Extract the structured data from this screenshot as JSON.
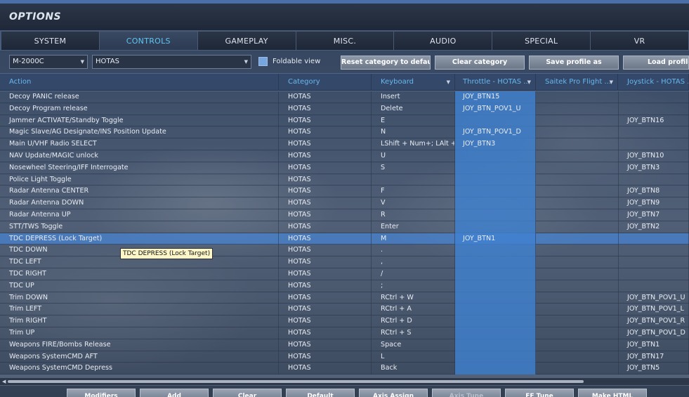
{
  "window": {
    "title": "OPTIONS"
  },
  "tabs": [
    {
      "label": "SYSTEM",
      "active": false
    },
    {
      "label": "CONTROLS",
      "active": true
    },
    {
      "label": "GAMEPLAY",
      "active": false
    },
    {
      "label": "MISC.",
      "active": false
    },
    {
      "label": "AUDIO",
      "active": false
    },
    {
      "label": "SPECIAL",
      "active": false
    },
    {
      "label": "VR",
      "active": false
    }
  ],
  "toolbar": {
    "aircraft_select": "M-2000C",
    "category_select": "HOTAS",
    "foldable_view_label": "Foldable view",
    "foldable_view_checked": true,
    "reset_category_label": "Reset category to default",
    "clear_category_label": "Clear category",
    "save_profile_label": "Save profile as",
    "load_profile_label": "Load profile"
  },
  "columns": {
    "action": "Action",
    "category": "Category",
    "keyboard": "Keyboard",
    "throttle": "Throttle - HOTAS ...",
    "saitek": "Saitek Pro Flight ...",
    "joystick": "Joystick - HOTAS ..."
  },
  "rows": [
    {
      "action": "Decoy PANIC release",
      "category": "HOTAS",
      "keyboard": "Insert",
      "throttle": "JOY_BTN15",
      "saitek": "",
      "joystick": ""
    },
    {
      "action": "Decoy Program release",
      "category": "HOTAS",
      "keyboard": "Delete",
      "throttle": "JOY_BTN_POV1_U",
      "saitek": "",
      "joystick": ""
    },
    {
      "action": "Jammer ACTIVATE/Standby Toggle",
      "category": "HOTAS",
      "keyboard": "E",
      "throttle": "",
      "saitek": "",
      "joystick": "JOY_BTN16"
    },
    {
      "action": "Magic Slave/AG Designate/INS Position Update",
      "category": "HOTAS",
      "keyboard": "N",
      "throttle": "JOY_BTN_POV1_D",
      "saitek": "",
      "joystick": ""
    },
    {
      "action": "Main U/VHF Radio SELECT",
      "category": "HOTAS",
      "keyboard": "LShift + Num+; LAlt +",
      "throttle": "JOY_BTN3",
      "saitek": "",
      "joystick": ""
    },
    {
      "action": "NAV Update/MAGIC unlock",
      "category": "HOTAS",
      "keyboard": "U",
      "throttle": "",
      "saitek": "",
      "joystick": "JOY_BTN10"
    },
    {
      "action": "Nosewheel Steering/IFF Interrogate",
      "category": "HOTAS",
      "keyboard": "S",
      "throttle": "",
      "saitek": "",
      "joystick": "JOY_BTN3"
    },
    {
      "action": "Police Light Toggle",
      "category": "HOTAS",
      "keyboard": "",
      "throttle": "",
      "saitek": "",
      "joystick": ""
    },
    {
      "action": "Radar Antenna CENTER",
      "category": "HOTAS",
      "keyboard": "F",
      "throttle": "",
      "saitek": "",
      "joystick": "JOY_BTN8"
    },
    {
      "action": "Radar Antenna DOWN",
      "category": "HOTAS",
      "keyboard": "V",
      "throttle": "",
      "saitek": "",
      "joystick": "JOY_BTN9"
    },
    {
      "action": "Radar Antenna UP",
      "category": "HOTAS",
      "keyboard": "R",
      "throttle": "",
      "saitek": "",
      "joystick": "JOY_BTN7"
    },
    {
      "action": "STT/TWS Toggle",
      "category": "HOTAS",
      "keyboard": "Enter",
      "throttle": "",
      "saitek": "",
      "joystick": "JOY_BTN2"
    },
    {
      "action": "TDC DEPRESS (Lock Target)",
      "category": "HOTAS",
      "keyboard": "M",
      "throttle": "JOY_BTN1",
      "saitek": "",
      "joystick": "",
      "selected": true
    },
    {
      "action": "TDC DOWN",
      "category": "HOTAS",
      "keyboard": ".",
      "throttle": "",
      "saitek": "",
      "joystick": ""
    },
    {
      "action": "TDC LEFT",
      "category": "HOTAS",
      "keyboard": ",",
      "throttle": "",
      "saitek": "",
      "joystick": ""
    },
    {
      "action": "TDC RIGHT",
      "category": "HOTAS",
      "keyboard": "/",
      "throttle": "",
      "saitek": "",
      "joystick": ""
    },
    {
      "action": "TDC UP",
      "category": "HOTAS",
      "keyboard": ";",
      "throttle": "",
      "saitek": "",
      "joystick": ""
    },
    {
      "action": "Trim DOWN",
      "category": "HOTAS",
      "keyboard": "RCtrl + W",
      "throttle": "",
      "saitek": "",
      "joystick": "JOY_BTN_POV1_U"
    },
    {
      "action": "Trim LEFT",
      "category": "HOTAS",
      "keyboard": "RCtrl + A",
      "throttle": "",
      "saitek": "",
      "joystick": "JOY_BTN_POV1_L"
    },
    {
      "action": "Trim RIGHT",
      "category": "HOTAS",
      "keyboard": "RCtrl + D",
      "throttle": "",
      "saitek": "",
      "joystick": "JOY_BTN_POV1_R"
    },
    {
      "action": "Trim UP",
      "category": "HOTAS",
      "keyboard": "RCtrl + S",
      "throttle": "",
      "saitek": "",
      "joystick": "JOY_BTN_POV1_D"
    },
    {
      "action": "Weapons FIRE/Bombs Release",
      "category": "HOTAS",
      "keyboard": "Space",
      "throttle": "",
      "saitek": "",
      "joystick": "JOY_BTN1"
    },
    {
      "action": "Weapons SystemCMD AFT",
      "category": "HOTAS",
      "keyboard": "L",
      "throttle": "",
      "saitek": "",
      "joystick": "JOY_BTN17"
    },
    {
      "action": "Weapons SystemCMD Depress",
      "category": "HOTAS",
      "keyboard": "Back",
      "throttle": "",
      "saitek": "",
      "joystick": "JOY_BTN5"
    }
  ],
  "tooltip": "TDC DEPRESS (Lock Target)",
  "bottom_buttons": [
    {
      "label": "Modifiers",
      "enabled": true
    },
    {
      "label": "Add",
      "enabled": true
    },
    {
      "label": "Clear",
      "enabled": true
    },
    {
      "label": "Default",
      "enabled": true
    },
    {
      "label": "Axis Assign",
      "enabled": true
    },
    {
      "label": "Axis Tune",
      "enabled": false
    },
    {
      "label": "FF Tune",
      "enabled": true
    },
    {
      "label": "Make HTML",
      "enabled": true
    }
  ],
  "icons": {
    "dropdown_arrow": "chevron-down-icon",
    "scroll_left": "arrow-left-icon"
  },
  "colors": {
    "accent": "#5fc6f2",
    "header_text": "#66b8ee",
    "selected_row": "#4278be",
    "throttle_column": "#4082d2",
    "tooltip_bg": "#fdf6c8"
  }
}
